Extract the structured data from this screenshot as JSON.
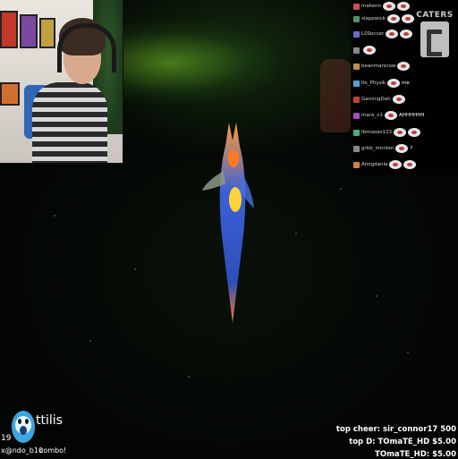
{
  "chat": {
    "messages": [
      {
        "user": "makenn",
        "msg": "",
        "badge_color": "#c85050"
      },
      {
        "user": "slappwick",
        "msg": "",
        "badge_color": "#5a8f5a"
      },
      {
        "user": "L0Soccer",
        "msg": "",
        "badge_color": "#6c6cd0"
      },
      {
        "user": "",
        "msg": "",
        "badge_color": "#888888"
      },
      {
        "user": "beanmanicow",
        "msg": "",
        "badge_color": "#c09040"
      },
      {
        "user": "Its_Physik",
        "msg": "me",
        "badge_color": "#4fa0d8"
      },
      {
        "user": "GamingDah",
        "msg": "",
        "badge_color": "#c04040"
      },
      {
        "user": "mara_o1",
        "msg": "AHHHHHH",
        "badge_color": "#a050c0"
      },
      {
        "user": "Ibmoozo123",
        "msg": "",
        "badge_color": "#40b080"
      },
      {
        "user": "grbb_mnnlen",
        "msg": "?",
        "badge_color": "#888888"
      },
      {
        "user": "Amigdanla",
        "msg": "",
        "badge_color": "#d08040"
      }
    ]
  },
  "watermark": {
    "label": "CATERS"
  },
  "alert": {
    "count": "19",
    "name": "ttilis",
    "user": "x@ndo_b10",
    "combo": "combo!"
  },
  "cheers": {
    "top_cheer": "top cheer: sir_connor17 500",
    "top_d1": "top D: TOmaTE_HD $5.00",
    "top_d2": "TOmaTE_HD: $5.00"
  },
  "colors": {
    "creature_body": "#3a5fd8",
    "creature_accent": "#ff8a1a",
    "alert_avatar": "#3aa8e0"
  }
}
